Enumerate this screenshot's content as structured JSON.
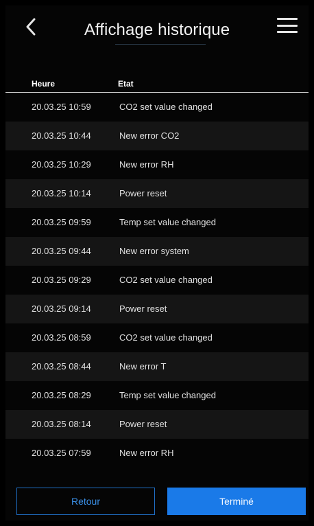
{
  "header": {
    "title": "Affichage historique"
  },
  "table": {
    "columns": [
      "Heure",
      "Etat"
    ],
    "rows": [
      {
        "time": "20.03.25 10:59",
        "state": "CO2 set value changed"
      },
      {
        "time": "20.03.25 10:44",
        "state": "New error CO2"
      },
      {
        "time": "20.03.25 10:29",
        "state": "New error RH"
      },
      {
        "time": "20.03.25 10:14",
        "state": "Power reset"
      },
      {
        "time": "20.03.25 09:59",
        "state": "Temp set value changed"
      },
      {
        "time": "20.03.25 09:44",
        "state": "New error system"
      },
      {
        "time": "20.03.25 09:29",
        "state": "CO2 set value changed"
      },
      {
        "time": "20.03.25 09:14",
        "state": "Power reset"
      },
      {
        "time": "20.03.25 08:59",
        "state": "CO2 set value changed"
      },
      {
        "time": "20.03.25 08:44",
        "state": "New error T"
      },
      {
        "time": "20.03.25 08:29",
        "state": "Temp set value changed"
      },
      {
        "time": "20.03.25 08:14",
        "state": "Power reset"
      },
      {
        "time": "20.03.25 07:59",
        "state": "New error RH"
      }
    ]
  },
  "footer": {
    "back_label": "Retour",
    "done_label": "Terminé"
  },
  "colors": {
    "accent": "#1a7ae8",
    "background": "#050505",
    "row_alt": "#151515"
  },
  "icons": {
    "back": "chevron-left-icon",
    "menu": "hamburger-menu-icon"
  }
}
